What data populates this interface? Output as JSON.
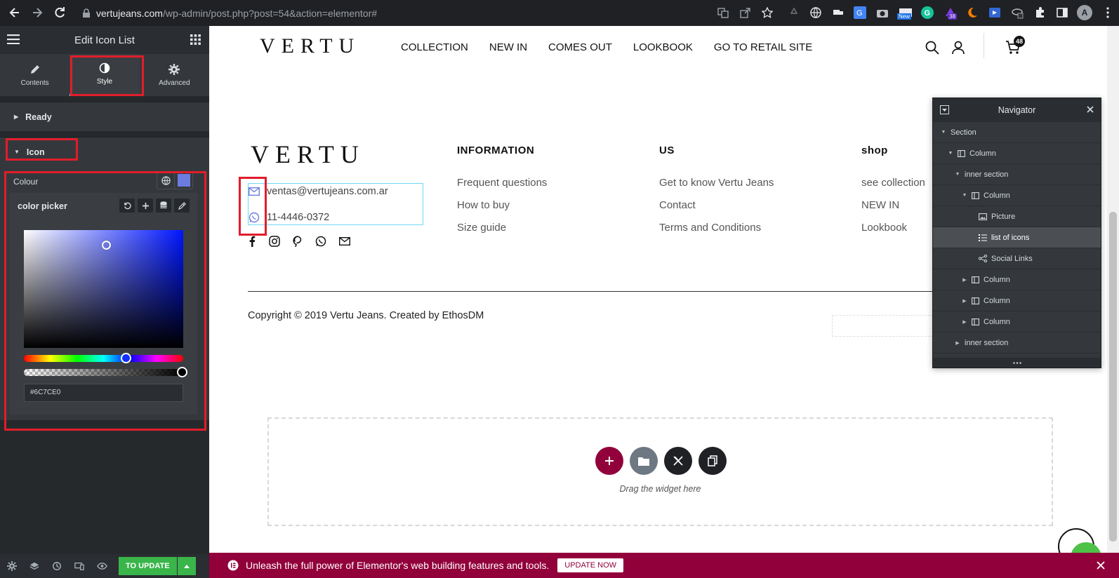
{
  "browser": {
    "url_host": "vertujeans.com",
    "url_path": "/wp-admin/post.php?post=54&action=elementor#",
    "ext_badge_new": "New",
    "ext_badge_count": "38",
    "profile_initial": "A"
  },
  "panel": {
    "title": "Edit Icon List",
    "tabs": [
      {
        "label": "Contents",
        "icon": "pencil-icon"
      },
      {
        "label": "Style",
        "icon": "half-circle-icon"
      },
      {
        "label": "Advanced",
        "icon": "gear-icon"
      }
    ],
    "section_ready": "Ready",
    "section_icon": "Icon",
    "colour_label": "Colour",
    "picker_title": "color picker",
    "hex_value": "#6C7CE0",
    "update_button": "TO UPDATE"
  },
  "site": {
    "logo": "VERTU",
    "menu": [
      "COLLECTION",
      "NEW IN",
      "COMES OUT",
      "LOOKBOOK",
      "GO TO RETAIL SITE"
    ],
    "cart_count": "48",
    "footer_logo": "VERTU",
    "contact_email": "ventas@vertujeans.com.ar",
    "contact_phone": "11-4446-0372",
    "col_information": {
      "title": "INFORMATION",
      "links": [
        "Frequent questions",
        "How to buy",
        "Size guide"
      ]
    },
    "col_us": {
      "title": "US",
      "links": [
        "Get to know Vertu Jeans",
        "Contact",
        "Terms and Conditions"
      ]
    },
    "col_shop": {
      "title": "shop",
      "links": [
        "see collection",
        "NEW IN",
        "Lookbook"
      ]
    },
    "copyright": "Copyright © 2019 Vertu Jeans. Created by EthosDM",
    "drag_hint": "Drag the widget here"
  },
  "navigator": {
    "title": "Navigator",
    "rows": [
      {
        "label": "Section"
      },
      {
        "label": "Column"
      },
      {
        "label": "inner section"
      },
      {
        "label": "Column"
      },
      {
        "label": "Picture"
      },
      {
        "label": "list of icons"
      },
      {
        "label": "Social Links"
      },
      {
        "label": "Column"
      },
      {
        "label": "Column"
      },
      {
        "label": "Column"
      },
      {
        "label": "inner section"
      }
    ]
  },
  "promo": {
    "text": "Unleash the full power of Elementor's web building features and tools.",
    "button": "UPDATE NOW"
  },
  "colors": {
    "accent_pick": "#6C7CE0",
    "elementor_maroon": "#92003B",
    "update_green": "#39B54A",
    "highlight_red": "#E11D2A"
  }
}
